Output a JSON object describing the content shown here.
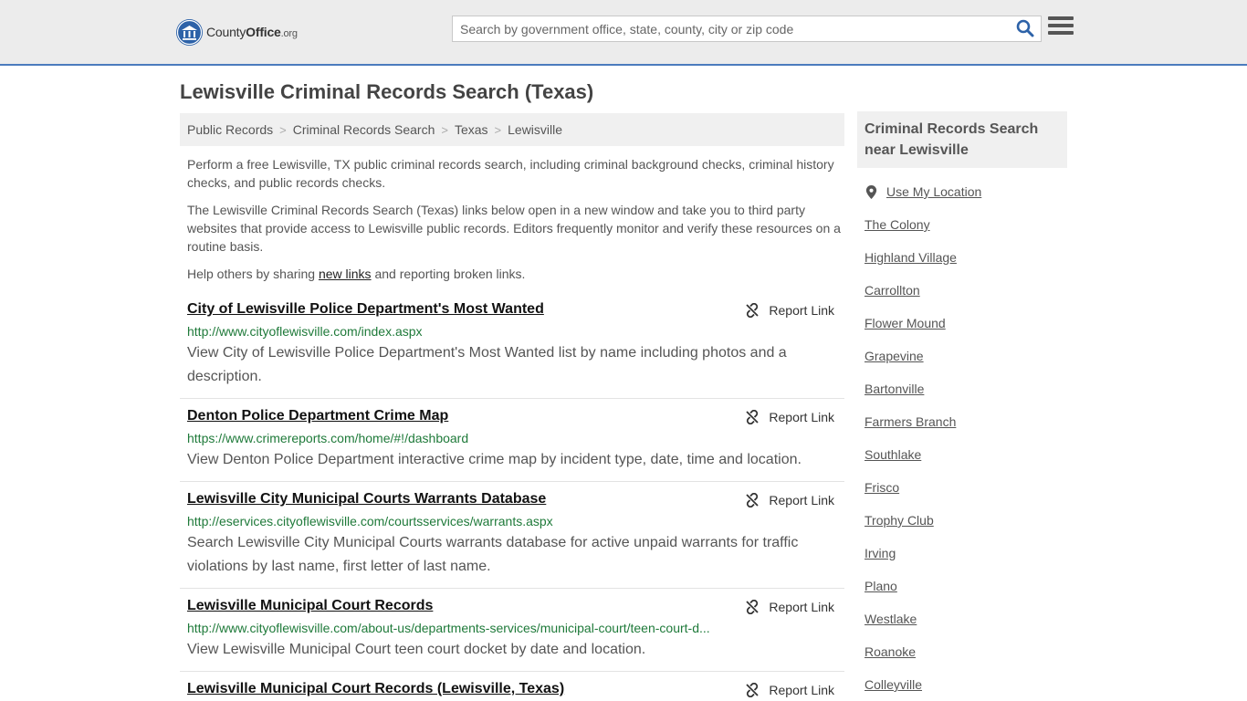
{
  "header": {
    "logo_main": "County",
    "logo_bold": "Office",
    "logo_tld": ".org",
    "search_placeholder": "Search by government office, state, county, city or zip code"
  },
  "page": {
    "title": "Lewisville Criminal Records Search (Texas)"
  },
  "breadcrumb": [
    "Public Records",
    "Criminal Records Search",
    "Texas",
    "Lewisville"
  ],
  "intro": {
    "p1": "Perform a free Lewisville, TX public criminal records search, including criminal background checks, criminal history checks, and public records checks.",
    "p2": "The Lewisville Criminal Records Search (Texas) links below open in a new window and take you to third party websites that provide access to Lewisville public records. Editors frequently monitor and verify these resources on a routine basis.",
    "p3_before": "Help others by sharing ",
    "p3_link": "new links",
    "p3_after": " and reporting broken links."
  },
  "report_label": "Report Link",
  "results": [
    {
      "title": "City of Lewisville Police Department's Most Wanted",
      "url": "http://www.cityoflewisville.com/index.aspx",
      "desc": "View City of Lewisville Police Department's Most Wanted list by name including photos and a description."
    },
    {
      "title": "Denton Police Department Crime Map",
      "url": "https://www.crimereports.com/home/#!/dashboard",
      "desc": "View Denton Police Department interactive crime map by incident type, date, time and location."
    },
    {
      "title": "Lewisville City Municipal Courts Warrants Database",
      "url": "http://eservices.cityoflewisville.com/courtsservices/warrants.aspx",
      "desc": "Search Lewisville City Municipal Courts warrants database for active unpaid warrants for traffic violations by last name, first letter of last name."
    },
    {
      "title": "Lewisville Municipal Court Records",
      "url": "http://www.cityoflewisville.com/about-us/departments-services/municipal-court/teen-court-d...",
      "desc": "View Lewisville Municipal Court teen court docket by date and location."
    },
    {
      "title": "Lewisville Municipal Court Records (Lewisville, Texas)",
      "url": "",
      "desc": ""
    }
  ],
  "sidebar": {
    "heading": "Criminal Records Search near Lewisville",
    "use_location": "Use My Location",
    "cities": [
      "The Colony",
      "Highland Village",
      "Carrollton",
      "Flower Mound",
      "Grapevine",
      "Bartonville",
      "Farmers Branch",
      "Southlake",
      "Frisco",
      "Trophy Club",
      "Irving",
      "Plano",
      "Westlake",
      "Roanoke",
      "Colleyville"
    ]
  },
  "colors": {
    "brand_blue": "#2d62a8",
    "header_border": "#4b7bbd",
    "url_green": "#1f7a3a"
  },
  "icons": [
    "search-icon",
    "menu-icon",
    "broken-link-icon",
    "location-pin-icon",
    "logo-seal-icon"
  ]
}
